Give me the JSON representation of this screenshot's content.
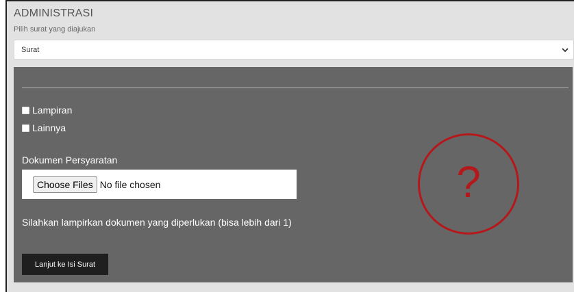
{
  "header": {
    "title": "ADMINISTRASI",
    "subtitle": "Pilih surat yang diajukan"
  },
  "select": {
    "value": "Surat",
    "icon": "chevron-down-icon"
  },
  "panel": {
    "checkboxes": [
      {
        "label": "Lampiran",
        "checked": false
      },
      {
        "label": "Lainnya",
        "checked": false
      }
    ],
    "document_label": "Dokumen Persyaratan",
    "file_input": {
      "button_label": "Choose Files",
      "status": "No file chosen"
    },
    "help_text": "Silahkan lampirkan dokumen yang diperlukan (bisa lebih dari 1)",
    "submit_label": "Lanjut ke Isi Surat",
    "overlay": {
      "glyph": "?",
      "color": "#b5181b"
    }
  },
  "colors": {
    "panel_bg": "#666666",
    "header_bg": "#e2e2e2",
    "button_bg": "#1f1f1f"
  }
}
